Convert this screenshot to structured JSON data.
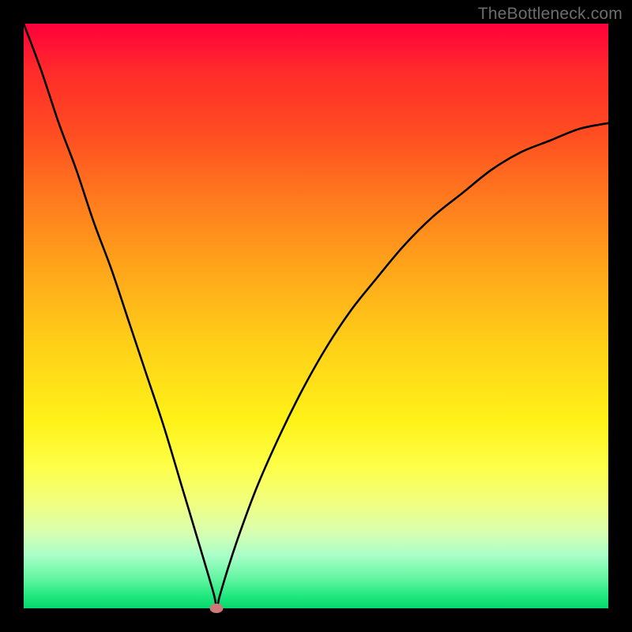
{
  "watermark": "TheBottleneck.com",
  "chart_data": {
    "type": "line",
    "title": "",
    "xlabel": "",
    "ylabel": "",
    "xlim": [
      0,
      100
    ],
    "ylim": [
      0,
      100
    ],
    "grid": false,
    "marker": {
      "x": 33,
      "y": 0
    },
    "series": [
      {
        "name": "bottleneck-curve",
        "x": [
          0,
          3,
          6,
          9,
          12,
          15,
          18,
          21,
          24,
          27,
          30,
          32.5,
          33,
          33.5,
          35,
          37,
          40,
          44,
          48,
          52,
          56,
          60,
          65,
          70,
          75,
          80,
          85,
          90,
          95,
          100
        ],
        "values": [
          100,
          92,
          83,
          75,
          66,
          58,
          49,
          40,
          31,
          21,
          11,
          2.5,
          0,
          2,
          7,
          13,
          21,
          30,
          38,
          45,
          51,
          56,
          62,
          67,
          71,
          75,
          78,
          80,
          82,
          83
        ]
      }
    ],
    "gradient_stops": [
      {
        "pos": 0,
        "color": "#ff003c"
      },
      {
        "pos": 8,
        "color": "#ff2a2a"
      },
      {
        "pos": 18,
        "color": "#ff4a22"
      },
      {
        "pos": 30,
        "color": "#ff7a1e"
      },
      {
        "pos": 42,
        "color": "#ffa61a"
      },
      {
        "pos": 55,
        "color": "#ffd018"
      },
      {
        "pos": 68,
        "color": "#fff218"
      },
      {
        "pos": 76,
        "color": "#fdff4a"
      },
      {
        "pos": 82,
        "color": "#f0ff80"
      },
      {
        "pos": 87,
        "color": "#d8ffb0"
      },
      {
        "pos": 91,
        "color": "#a8ffc8"
      },
      {
        "pos": 95,
        "color": "#60f5a0"
      },
      {
        "pos": 98,
        "color": "#1ee87d"
      },
      {
        "pos": 100,
        "color": "#07d86c"
      }
    ]
  }
}
